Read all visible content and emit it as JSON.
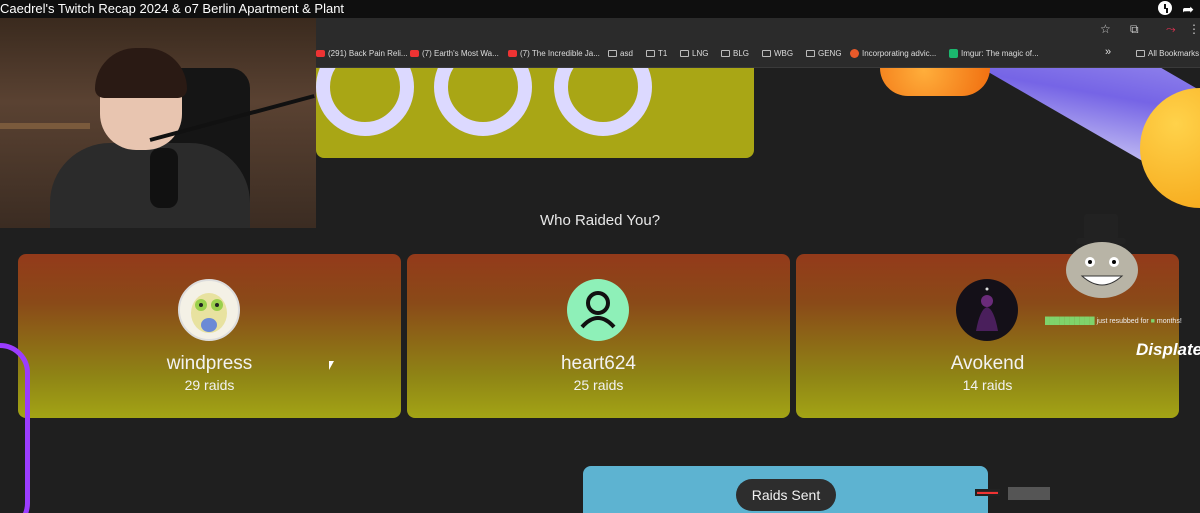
{
  "video": {
    "title": "Caedrel's Twitch Recap 2024 & o7 Berlin Apartment & Plant"
  },
  "browser": {
    "bookmarks": [
      {
        "label": "(291) Back Pain Reli...",
        "type": "yt"
      },
      {
        "label": "(7) Earth's Most Wa...",
        "type": "yt"
      },
      {
        "label": "(7) The Incredible Ja...",
        "type": "yt"
      },
      {
        "label": "asd",
        "type": "folder"
      },
      {
        "label": "T1",
        "type": "folder"
      },
      {
        "label": "LNG",
        "type": "folder"
      },
      {
        "label": "BLG",
        "type": "folder"
      },
      {
        "label": "WBG",
        "type": "folder"
      },
      {
        "label": "GENG",
        "type": "folder"
      },
      {
        "label": "Incorporating advic...",
        "type": "site"
      },
      {
        "label": "Imgur: The magic of...",
        "type": "site"
      }
    ],
    "more_label": "»",
    "all_bookmarks": "All Bookmarks"
  },
  "raids": {
    "heading": "Who Raided You?",
    "cards": [
      {
        "name": "windpress",
        "count": "29 raids"
      },
      {
        "name": "heart624",
        "count": "25 raids"
      },
      {
        "name": "Avokend",
        "count": "14 raids"
      }
    ],
    "sent_label": "Raids Sent"
  },
  "overlay": {
    "sub_text": "just resubbed for",
    "sub_suffix": "months!",
    "brand": "Displate"
  },
  "colors": {
    "card_top": "#933a1a",
    "card_bottom": "#a3a415",
    "green_block": "#a9a615",
    "blue_block": "#5db3d1"
  }
}
